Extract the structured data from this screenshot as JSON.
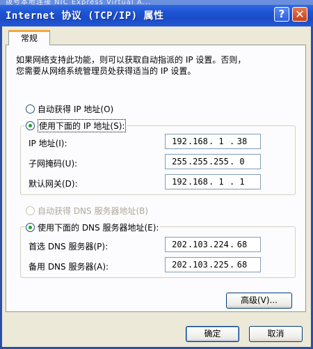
{
  "background_window": {
    "title_fragment": "拨号本地连接  NIC Express Virtual A..."
  },
  "window": {
    "title": "Internet 协议 (TCP/IP) 属性"
  },
  "titlebar": {
    "help_label": "?",
    "close_label": "✕"
  },
  "tabs": [
    {
      "label": "常规"
    }
  ],
  "description": {
    "line1": "如果网络支持此功能，则可以获取自动指派的 IP 设置。否则，",
    "line2": "您需要从网络系统管理员处获得适当的 IP 设置。"
  },
  "ip": {
    "auto_label": "自动获得 IP 地址(O)",
    "manual_label": "使用下面的 IP 地址(S):",
    "selected": "manual",
    "fields": [
      {
        "label": "IP 地址(I):",
        "octets": [
          "192",
          "168",
          "1",
          "38"
        ]
      },
      {
        "label": "子网掩码(U):",
        "octets": [
          "255",
          "255",
          "255",
          "0"
        ]
      },
      {
        "label": "默认网关(D):",
        "octets": [
          "192",
          "168",
          "1",
          "1"
        ]
      }
    ]
  },
  "dns": {
    "auto_label": "自动获得 DNS 服务器地址(B)",
    "manual_label": "使用下面的 DNS 服务器地址(E):",
    "selected": "manual",
    "fields": [
      {
        "label": "首选 DNS 服务器(P):",
        "octets": [
          "202",
          "103",
          "224",
          "68"
        ]
      },
      {
        "label": "备用 DNS 服务器(A):",
        "octets": [
          "202",
          "103",
          "225",
          "68"
        ]
      }
    ]
  },
  "buttons": {
    "advanced": "高级(V)...",
    "ok": "确定",
    "cancel": "取消"
  }
}
